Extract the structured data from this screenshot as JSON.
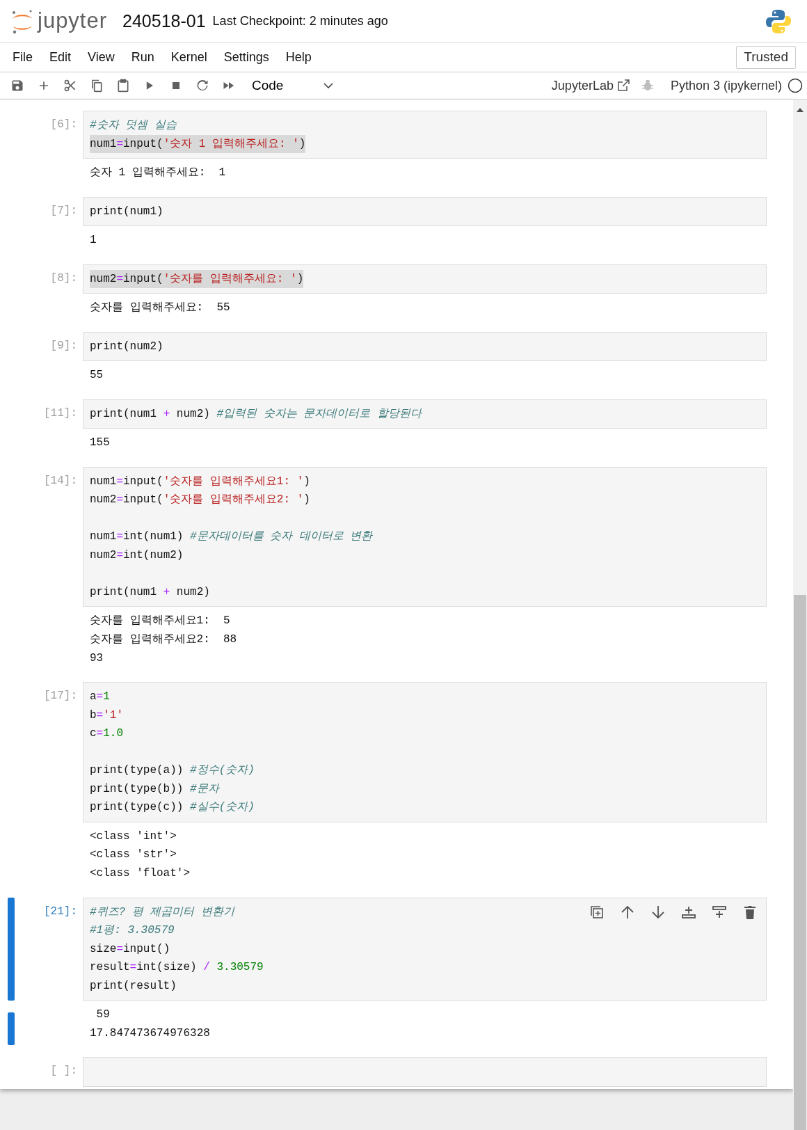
{
  "header": {
    "logo_text": "jupyter",
    "title": "240518-01",
    "checkpoint": "Last Checkpoint: 2 minutes ago"
  },
  "menu": [
    "File",
    "Edit",
    "View",
    "Run",
    "Kernel",
    "Settings",
    "Help"
  ],
  "trusted": "Trusted",
  "toolbar": {
    "cell_type": "Code",
    "jupyterlab": "JupyterLab",
    "kernel": "Python 3 (ipykernel)"
  },
  "cells": [
    {
      "prompt": "[6]:",
      "active": false,
      "lines": [
        {
          "kind": "code",
          "highlighted": false,
          "tokens": [
            {
              "kind": "comment",
              "text": "#숫자 덧셈 실습"
            }
          ]
        },
        {
          "kind": "code",
          "highlighted": true,
          "tokens": [
            {
              "kind": "plain",
              "text": "num1"
            },
            {
              "kind": "op",
              "text": "="
            },
            {
              "kind": "plain",
              "text": "input("
            },
            {
              "kind": "str",
              "text": "'숫자 1 입력해주세요: '"
            },
            {
              "kind": "plain",
              "text": ")"
            }
          ]
        }
      ],
      "outputs": [
        "숫자 1 입력해주세요:  1"
      ]
    },
    {
      "prompt": "[7]:",
      "active": false,
      "lines": [
        {
          "kind": "code",
          "highlighted": false,
          "tokens": [
            {
              "kind": "plain",
              "text": "print(num1)"
            }
          ]
        }
      ],
      "outputs": [
        "1"
      ]
    },
    {
      "prompt": "[8]:",
      "active": false,
      "lines": [
        {
          "kind": "code",
          "highlighted": true,
          "tokens": [
            {
              "kind": "plain",
              "text": "num2"
            },
            {
              "kind": "op",
              "text": "="
            },
            {
              "kind": "plain",
              "text": "input("
            },
            {
              "kind": "str",
              "text": "'숫자를 입력해주세요: '"
            },
            {
              "kind": "plain",
              "text": ")"
            }
          ]
        }
      ],
      "outputs": [
        "숫자를 입력해주세요:  55"
      ]
    },
    {
      "prompt": "[9]:",
      "active": false,
      "lines": [
        {
          "kind": "code",
          "highlighted": false,
          "tokens": [
            {
              "kind": "plain",
              "text": "print(num2)"
            }
          ]
        }
      ],
      "outputs": [
        "55"
      ]
    },
    {
      "prompt": "[11]:",
      "active": false,
      "lines": [
        {
          "kind": "code",
          "highlighted": false,
          "tokens": [
            {
              "kind": "plain",
              "text": "print(num1 "
            },
            {
              "kind": "op",
              "text": "+"
            },
            {
              "kind": "plain",
              "text": " num2) "
            },
            {
              "kind": "comment",
              "text": "#입력된 숫자는 문자데이터로 할당된다"
            }
          ]
        }
      ],
      "outputs": [
        "155"
      ]
    },
    {
      "prompt": "[14]:",
      "active": false,
      "lines": [
        {
          "kind": "code",
          "highlighted": false,
          "tokens": [
            {
              "kind": "plain",
              "text": "num1"
            },
            {
              "kind": "op",
              "text": "="
            },
            {
              "kind": "plain",
              "text": "input("
            },
            {
              "kind": "str",
              "text": "'숫자를 입력해주세요1: '"
            },
            {
              "kind": "plain",
              "text": ")"
            }
          ]
        },
        {
          "kind": "code",
          "highlighted": false,
          "tokens": [
            {
              "kind": "plain",
              "text": "num2"
            },
            {
              "kind": "op",
              "text": "="
            },
            {
              "kind": "plain",
              "text": "input("
            },
            {
              "kind": "str",
              "text": "'숫자를 입력해주세요2: '"
            },
            {
              "kind": "plain",
              "text": ")"
            }
          ]
        },
        {
          "kind": "blank"
        },
        {
          "kind": "code",
          "highlighted": false,
          "tokens": [
            {
              "kind": "plain",
              "text": "num1"
            },
            {
              "kind": "op",
              "text": "="
            },
            {
              "kind": "plain",
              "text": "int(num1) "
            },
            {
              "kind": "comment",
              "text": "#문자데이터를 숫자 데이터로 변환"
            }
          ]
        },
        {
          "kind": "code",
          "highlighted": false,
          "tokens": [
            {
              "kind": "plain",
              "text": "num2"
            },
            {
              "kind": "op",
              "text": "="
            },
            {
              "kind": "plain",
              "text": "int(num2)"
            }
          ]
        },
        {
          "kind": "blank"
        },
        {
          "kind": "code",
          "highlighted": false,
          "tokens": [
            {
              "kind": "plain",
              "text": "print(num1 "
            },
            {
              "kind": "op",
              "text": "+"
            },
            {
              "kind": "plain",
              "text": " num2)"
            }
          ]
        }
      ],
      "outputs": [
        "숫자를 입력해주세요1:  5",
        "숫자를 입력해주세요2:  88",
        "93"
      ]
    },
    {
      "prompt": "[17]:",
      "active": false,
      "lines": [
        {
          "kind": "code",
          "highlighted": false,
          "tokens": [
            {
              "kind": "plain",
              "text": "a"
            },
            {
              "kind": "op",
              "text": "="
            },
            {
              "kind": "num",
              "text": "1"
            }
          ]
        },
        {
          "kind": "code",
          "highlighted": false,
          "tokens": [
            {
              "kind": "plain",
              "text": "b"
            },
            {
              "kind": "op",
              "text": "="
            },
            {
              "kind": "str",
              "text": "'1'"
            }
          ]
        },
        {
          "kind": "code",
          "highlighted": false,
          "tokens": [
            {
              "kind": "plain",
              "text": "c"
            },
            {
              "kind": "op",
              "text": "="
            },
            {
              "kind": "num",
              "text": "1.0"
            }
          ]
        },
        {
          "kind": "blank"
        },
        {
          "kind": "code",
          "highlighted": false,
          "tokens": [
            {
              "kind": "plain",
              "text": "print(type(a)) "
            },
            {
              "kind": "comment",
              "text": "#정수(숫자)"
            }
          ]
        },
        {
          "kind": "code",
          "highlighted": false,
          "tokens": [
            {
              "kind": "plain",
              "text": "print(type(b)) "
            },
            {
              "kind": "comment",
              "text": "#문자"
            }
          ]
        },
        {
          "kind": "code",
          "highlighted": false,
          "tokens": [
            {
              "kind": "plain",
              "text": "print(type(c)) "
            },
            {
              "kind": "comment",
              "text": "#실수(숫자)"
            }
          ]
        }
      ],
      "outputs": [
        "<class 'int'>",
        "<class 'str'>",
        "<class 'float'>"
      ]
    },
    {
      "prompt": "[21]:",
      "active": true,
      "lines": [
        {
          "kind": "code",
          "highlighted": false,
          "tokens": [
            {
              "kind": "comment",
              "text": "#퀴즈? 평 제곱미터 변환기"
            }
          ]
        },
        {
          "kind": "code",
          "highlighted": false,
          "tokens": [
            {
              "kind": "comment",
              "text": "#1평: 3.30579"
            }
          ]
        },
        {
          "kind": "code",
          "highlighted": false,
          "tokens": [
            {
              "kind": "plain",
              "text": "size"
            },
            {
              "kind": "op",
              "text": "="
            },
            {
              "kind": "plain",
              "text": "input()"
            }
          ]
        },
        {
          "kind": "code",
          "highlighted": false,
          "tokens": [
            {
              "kind": "plain",
              "text": "result"
            },
            {
              "kind": "op",
              "text": "="
            },
            {
              "kind": "plain",
              "text": "int(size) "
            },
            {
              "kind": "op",
              "text": "/"
            },
            {
              "kind": "num",
              "text": " 3.30579"
            }
          ]
        },
        {
          "kind": "code",
          "highlighted": false,
          "tokens": [
            {
              "kind": "plain",
              "text": "print(result)"
            }
          ]
        }
      ],
      "outputs": [
        " 59",
        "17.847473674976328"
      ]
    },
    {
      "prompt": "[ ]:",
      "active": false,
      "lines": [
        {
          "kind": "blank"
        }
      ]
    }
  ]
}
